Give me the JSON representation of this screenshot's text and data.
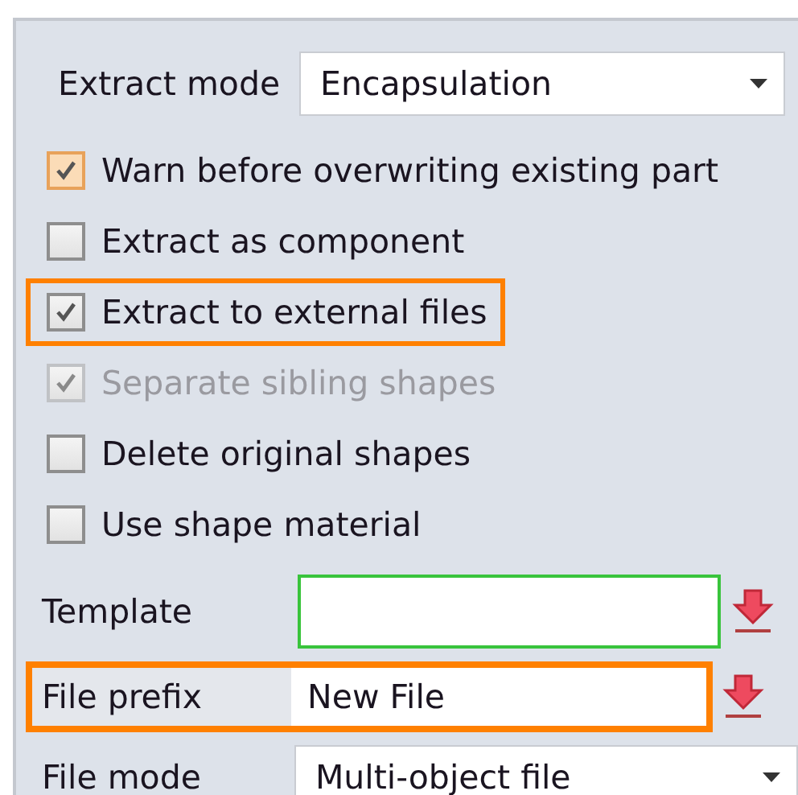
{
  "extract_mode": {
    "label": "Extract mode",
    "value": "Encapsulation"
  },
  "options": [
    {
      "label": "Warn before overwriting existing part",
      "checked": true,
      "disabled": false,
      "hovered": true,
      "highlighted": false
    },
    {
      "label": "Extract as component",
      "checked": false,
      "disabled": false,
      "hovered": false,
      "highlighted": false
    },
    {
      "label": "Extract to external files",
      "checked": true,
      "disabled": false,
      "hovered": false,
      "highlighted": true
    },
    {
      "label": "Separate sibling shapes",
      "checked": true,
      "disabled": true,
      "hovered": false,
      "highlighted": false
    },
    {
      "label": "Delete original shapes",
      "checked": false,
      "disabled": false,
      "hovered": false,
      "highlighted": false
    },
    {
      "label": "Use shape material",
      "checked": false,
      "disabled": false,
      "hovered": false,
      "highlighted": false
    }
  ],
  "template": {
    "label": "Template",
    "valid": true
  },
  "file_prefix": {
    "label": "File prefix",
    "value": "New File",
    "highlighted": true
  },
  "file_mode": {
    "label": "File mode",
    "value": "Multi-object file"
  }
}
